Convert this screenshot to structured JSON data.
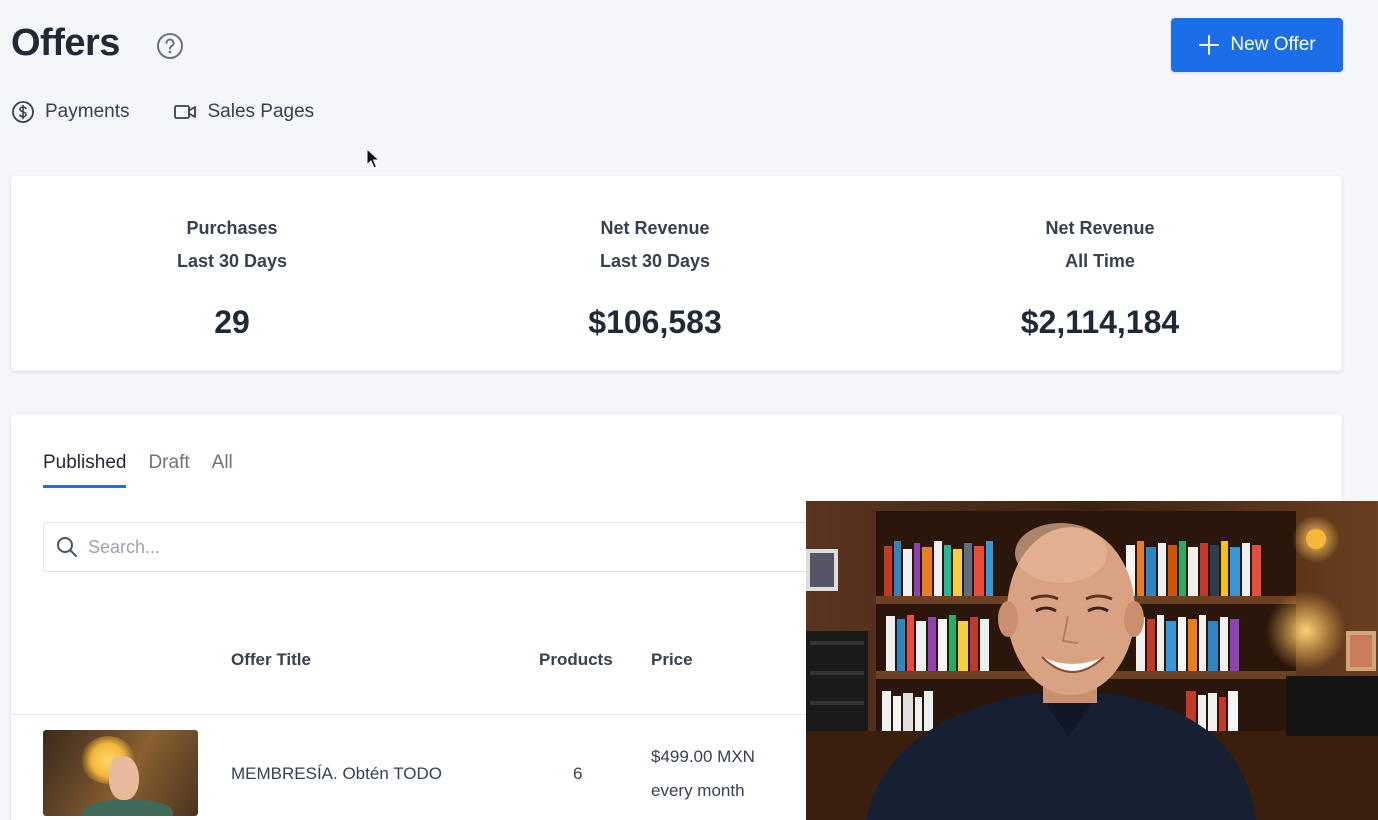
{
  "header": {
    "title": "Offers",
    "new_offer_label": "New Offer"
  },
  "subnav": {
    "payments": "Payments",
    "sales_pages": "Sales Pages"
  },
  "stats": [
    {
      "label_1": "Purchases",
      "label_2": "Last 30 Days",
      "value": "29"
    },
    {
      "label_1": "Net Revenue",
      "label_2": "Last 30 Days",
      "value": "$106,583"
    },
    {
      "label_1": "Net Revenue",
      "label_2": "All Time",
      "value": "$2,114,184"
    }
  ],
  "tabs": {
    "published": "Published",
    "draft": "Draft",
    "all": "All"
  },
  "search": {
    "placeholder": "Search..."
  },
  "table": {
    "columns": {
      "offer_title": "Offer Title",
      "products": "Products",
      "price": "Price"
    },
    "rows": [
      {
        "title": "MEMBRESÍA. Obtén TODO",
        "products": "6",
        "price_amount": "$499.00 MXN",
        "price_interval": "every month"
      }
    ]
  },
  "colors": {
    "accent": "#1a6fe8",
    "background": "#f4f6f9"
  }
}
